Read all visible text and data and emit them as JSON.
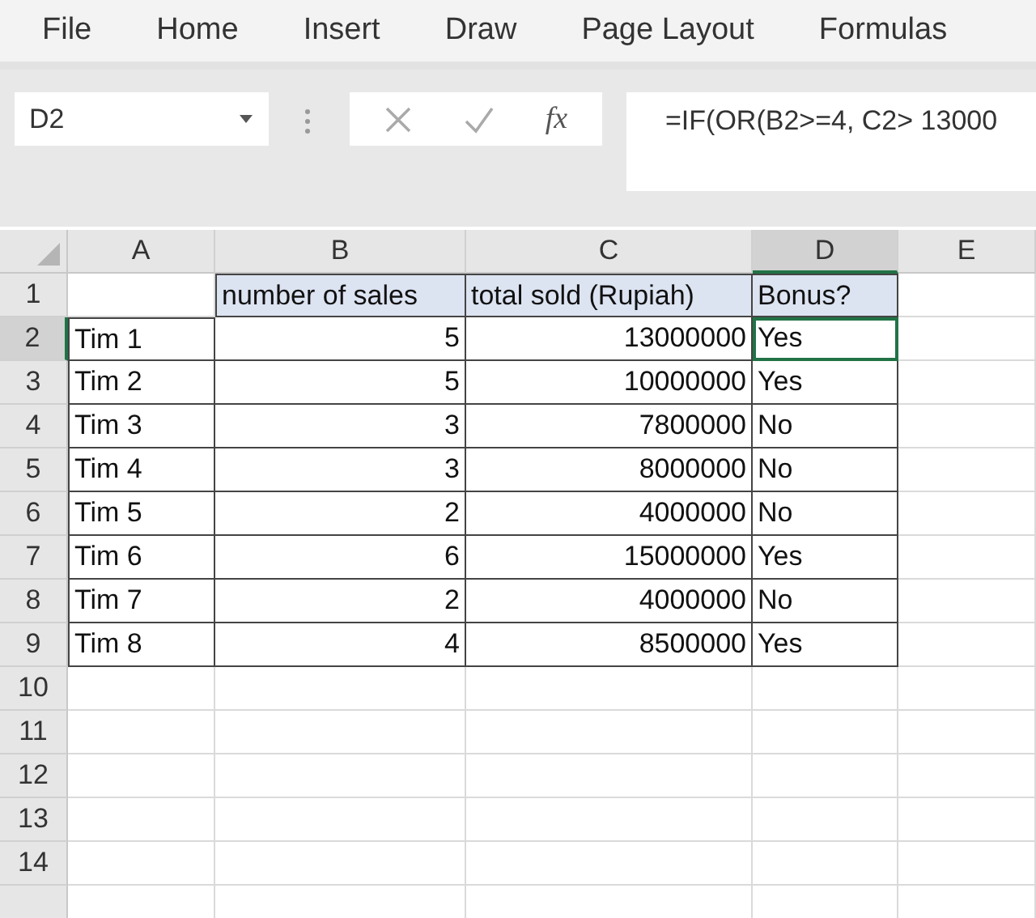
{
  "menu": [
    {
      "label": "File"
    },
    {
      "label": "Home"
    },
    {
      "label": "Insert"
    },
    {
      "label": "Draw"
    },
    {
      "label": "Page Layout"
    },
    {
      "label": "Formulas"
    }
  ],
  "name_box": {
    "value": "D2"
  },
  "function_button": {
    "label": "fx"
  },
  "formula_bar": {
    "value": "=IF(OR(B2>=4, C2> 13000"
  },
  "columns": [
    {
      "label": "A",
      "selected": false
    },
    {
      "label": "B",
      "selected": false
    },
    {
      "label": "C",
      "selected": false
    },
    {
      "label": "D",
      "selected": true
    },
    {
      "label": "E",
      "selected": false
    }
  ],
  "rows": [
    {
      "label": "1",
      "selected": false,
      "kind": "header",
      "cells": [
        {
          "text": "",
          "kind": "text"
        },
        {
          "text": "number of sales",
          "kind": "text"
        },
        {
          "text": "total sold (Rupiah)",
          "kind": "text"
        },
        {
          "text": "Bonus?",
          "kind": "text"
        }
      ]
    },
    {
      "label": "2",
      "selected": true,
      "kind": "data",
      "cells": [
        {
          "text": "Tim 1",
          "kind": "text"
        },
        {
          "text": "5",
          "kind": "number"
        },
        {
          "text": "13000000",
          "kind": "number"
        },
        {
          "text": "Yes",
          "kind": "text"
        }
      ]
    },
    {
      "label": "3",
      "selected": false,
      "kind": "data",
      "cells": [
        {
          "text": "Tim 2",
          "kind": "text"
        },
        {
          "text": "5",
          "kind": "number"
        },
        {
          "text": "10000000",
          "kind": "number"
        },
        {
          "text": "Yes",
          "kind": "text"
        }
      ]
    },
    {
      "label": "4",
      "selected": false,
      "kind": "data",
      "cells": [
        {
          "text": "Tim 3",
          "kind": "text"
        },
        {
          "text": "3",
          "kind": "number"
        },
        {
          "text": "7800000",
          "kind": "number"
        },
        {
          "text": "No",
          "kind": "text"
        }
      ]
    },
    {
      "label": "5",
      "selected": false,
      "kind": "data",
      "cells": [
        {
          "text": "Tim 4",
          "kind": "text"
        },
        {
          "text": "3",
          "kind": "number"
        },
        {
          "text": "8000000",
          "kind": "number"
        },
        {
          "text": "No",
          "kind": "text"
        }
      ]
    },
    {
      "label": "6",
      "selected": false,
      "kind": "data",
      "cells": [
        {
          "text": "Tim 5",
          "kind": "text"
        },
        {
          "text": "2",
          "kind": "number"
        },
        {
          "text": "4000000",
          "kind": "number"
        },
        {
          "text": "No",
          "kind": "text"
        }
      ]
    },
    {
      "label": "7",
      "selected": false,
      "kind": "data",
      "cells": [
        {
          "text": "Tim 6",
          "kind": "text"
        },
        {
          "text": "6",
          "kind": "number"
        },
        {
          "text": "15000000",
          "kind": "number"
        },
        {
          "text": "Yes",
          "kind": "text"
        }
      ]
    },
    {
      "label": "8",
      "selected": false,
      "kind": "data",
      "cells": [
        {
          "text": "Tim 7",
          "kind": "text"
        },
        {
          "text": "2",
          "kind": "number"
        },
        {
          "text": "4000000",
          "kind": "number"
        },
        {
          "text": "No",
          "kind": "text"
        }
      ]
    },
    {
      "label": "9",
      "selected": false,
      "kind": "data",
      "cells": [
        {
          "text": "Tim 8",
          "kind": "text"
        },
        {
          "text": "4",
          "kind": "number"
        },
        {
          "text": "8500000",
          "kind": "number"
        },
        {
          "text": "Yes",
          "kind": "text"
        }
      ]
    },
    {
      "label": "10",
      "selected": false,
      "kind": "empty"
    },
    {
      "label": "11",
      "selected": false,
      "kind": "empty"
    },
    {
      "label": "12",
      "selected": false,
      "kind": "empty"
    },
    {
      "label": "13",
      "selected": false,
      "kind": "empty"
    },
    {
      "label": "14",
      "selected": false,
      "kind": "empty"
    }
  ]
}
